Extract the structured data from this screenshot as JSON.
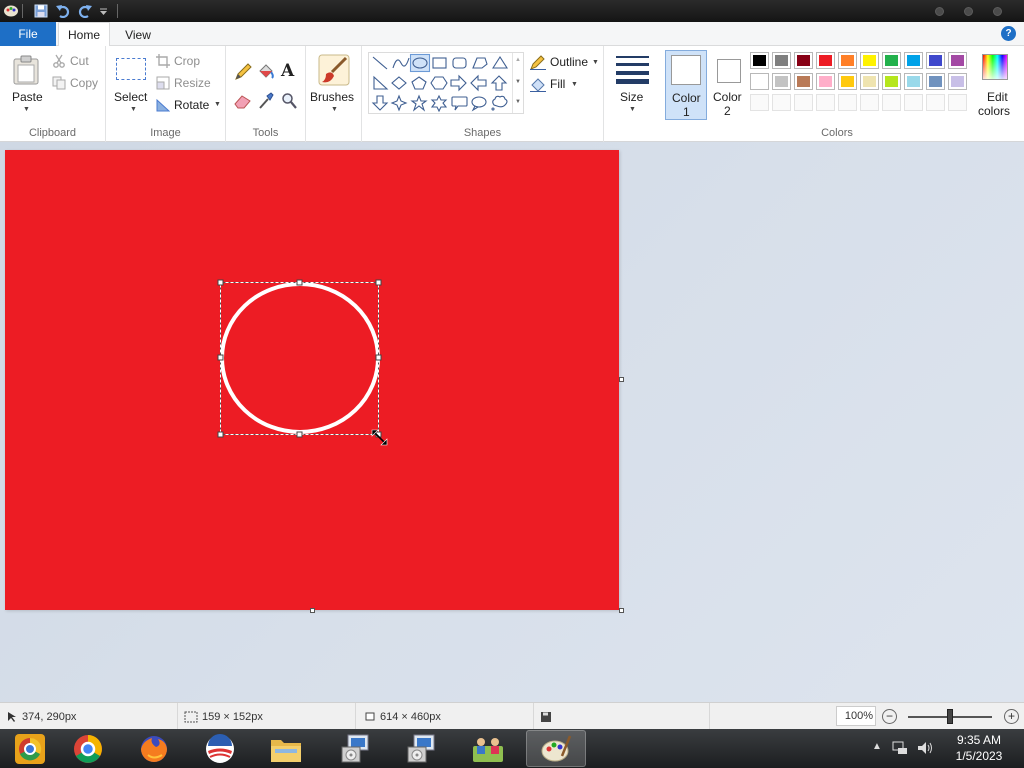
{
  "titlebar": {
    "quick_access": [
      "paint-app-icon",
      "save-icon",
      "undo-icon",
      "redo-icon",
      "customize-quick-access-icon"
    ]
  },
  "tabs": {
    "file": "File",
    "home": "Home",
    "view": "View",
    "help": "?"
  },
  "ribbon": {
    "clipboard": {
      "label": "Clipboard",
      "paste": "Paste",
      "cut": "Cut",
      "copy": "Copy"
    },
    "image": {
      "label": "Image",
      "select": "Select",
      "crop": "Crop",
      "resize": "Resize",
      "rotate": "Rotate"
    },
    "tools": {
      "label": "Tools"
    },
    "brushes": {
      "label": "Brushes"
    },
    "shapes": {
      "label": "Shapes",
      "outline": "Outline",
      "fill": "Fill",
      "items": [
        "line",
        "curve",
        "oval",
        "rectangle",
        "rounded-rectangle",
        "polygon",
        "triangle",
        "right-triangle",
        "diamond",
        "pentagon",
        "hexagon",
        "right-arrow",
        "left-arrow",
        "up-arrow",
        "down-arrow",
        "four-point-star",
        "five-point-star",
        "six-point-star",
        "rounded-rect-callout",
        "oval-callout",
        "cloud-callout"
      ],
      "selected": "oval"
    },
    "size": {
      "label": "Size"
    },
    "color1": {
      "label_line1": "Color",
      "label_line2": "1",
      "value": "#ffffff"
    },
    "color2": {
      "label_line1": "Color",
      "label_line2": "2",
      "value": "#ffffff"
    },
    "colors": {
      "label": "Colors",
      "edit_line1": "Edit",
      "edit_line2": "colors",
      "row1": [
        "#000000",
        "#7f7f7f",
        "#880015",
        "#ed1c24",
        "#ff7f27",
        "#fff200",
        "#22b14c",
        "#00a2e8",
        "#3f48cc",
        "#a349a4"
      ],
      "row2": [
        "#ffffff",
        "#c3c3c3",
        "#b97a57",
        "#ffaec9",
        "#ffc90e",
        "#efe4b0",
        "#b5e61d",
        "#99d9ea",
        "#7092be",
        "#c8bfe7"
      ]
    }
  },
  "canvas": {
    "background": "#ed1c24",
    "shape": "ellipse",
    "shape_color": "#ffffff"
  },
  "status": {
    "cursor_pos": "374, 290px",
    "selection_size": "159 × 152px",
    "canvas_size": "614 × 460px",
    "zoom": "100%",
    "zoom_level": 0.5
  },
  "taskbar": {
    "items": [
      "chrome-canary-icon",
      "chrome-icon",
      "firefox-icon",
      "obama-logo-icon",
      "file-explorer-icon",
      "installer-icon",
      "installer-icon-2",
      "network-people-icon",
      "paint-icon"
    ],
    "active": "paint-icon",
    "time": "9:35 AM",
    "date": "1/5/2023"
  }
}
